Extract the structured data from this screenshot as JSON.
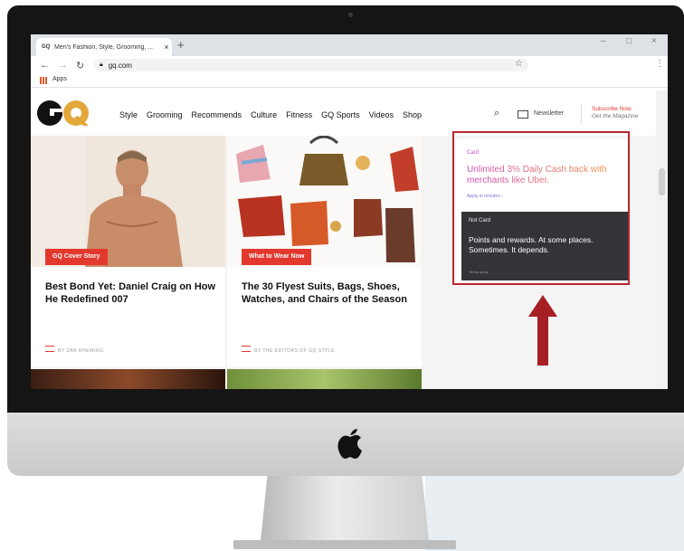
{
  "browser": {
    "tab_title": "Men's Fashion, Style, Grooming, ...",
    "tab_favicon_text": "GQ",
    "tab_close": "×",
    "new_tab": "+",
    "win_min": "–",
    "win_max": "□",
    "win_close": "×",
    "back": "←",
    "forward": "→",
    "reload": "↻",
    "url": "gq.com",
    "star": "☆",
    "menu": "⋮",
    "bookmarks_apps": "Apps"
  },
  "site": {
    "nav": [
      "Style",
      "Grooming",
      "Recommends",
      "Culture",
      "Fitness",
      "GQ Sports",
      "Videos",
      "Shop"
    ],
    "newsletter": "Newsletter",
    "subscribe_line1": "Subscribe Now",
    "subscribe_line2": "Get the Magazine"
  },
  "cards": [
    {
      "tag": "GQ Cover Story",
      "headline": "Best Bond Yet: Daniel Craig on How He Redefined 007",
      "byline": "BY ZAN RHEWING"
    },
    {
      "tag": "What to Wear Now",
      "headline": "The 30 Flyest Suits, Bags, Shoes, Watches, and Chairs of the Season",
      "byline": "BY THE EDITORS OF GQ STYLE"
    }
  ],
  "ad": {
    "brand": "Card",
    "headline": "Unlimited 3% Daily Cash back with merchants like Uber.",
    "apply": "Apply in minutes ›",
    "dark_label": "Not Card",
    "dark_copy": "Points and rewards. At some places. Sometimes. It depends.",
    "legal": "Terms apply"
  },
  "colors": {
    "accent_red": "#e2382e",
    "highlight_box": "#b8262c",
    "arrow": "#a51f24"
  },
  "icons": [
    "apple-icon",
    "search-icon",
    "mail-icon",
    "lock-icon",
    "star-icon",
    "up-arrow-icon"
  ]
}
